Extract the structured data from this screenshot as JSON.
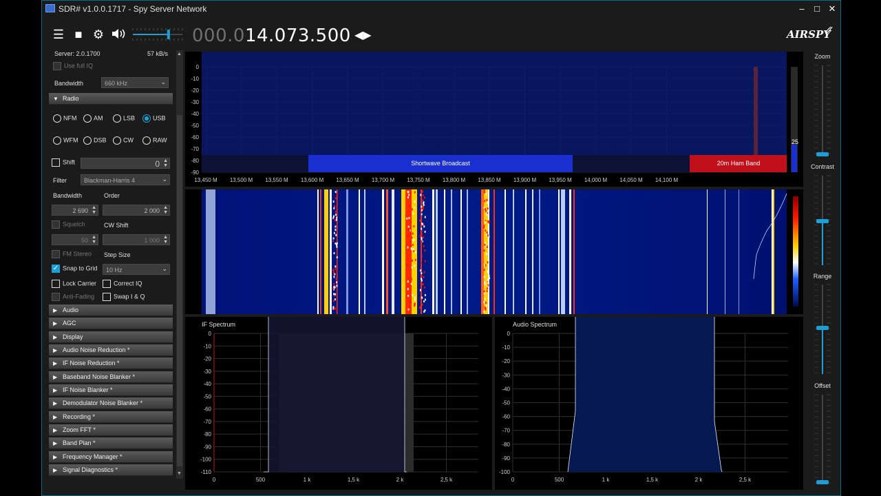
{
  "window": {
    "title": "SDR# v1.0.0.1717 - Spy Server Network"
  },
  "toolbar": {
    "freq_dim": "000.0",
    "freq_bright": "14.073.500",
    "logo": "AIRSPY",
    "volume_level": 0.72
  },
  "sidebar": {
    "server_label": "Server: 2.0.1700",
    "server_rate": "57 kB/s",
    "use_full_iq": "Use full IQ",
    "bandwidth_label": "Bandwidth",
    "bandwidth_value": "660 kHz",
    "radio_section": "Radio",
    "modes_row1": [
      "NFM",
      "AM",
      "LSB",
      "USB"
    ],
    "modes_row2": [
      "WFM",
      "DSB",
      "CW",
      "RAW"
    ],
    "selected_mode": "USB",
    "shift_label": "Shift",
    "shift_value": "0",
    "filter_label": "Filter",
    "filter_value": "Blackman-Harris 4",
    "bw_label": "Bandwidth",
    "order_label": "Order",
    "bw_value": "2 690",
    "order_value": "2 000",
    "squelch_label": "Squelch",
    "cw_shift_label": "CW Shift",
    "squelch_value": "50",
    "cw_shift_value": "1 000",
    "fm_stereo": "FM Stereo",
    "step_size_label": "Step Size",
    "snap_to_grid": "Snap to Grid",
    "step_value": "10 Hz",
    "lock_carrier": "Lock Carrier",
    "correct_iq": "Correct IQ",
    "anti_fading": "Anti-Fading",
    "swap_iq": "Swap I & Q",
    "sections": [
      "Audio",
      "AGC",
      "Display",
      "Audio Noise Reduction *",
      "IF Noise Reduction *",
      "Baseband Noise Blanker *",
      "IF Noise Blanker *",
      "Demodulator Noise Blanker *",
      "Recording *",
      "Zoom FFT *",
      "Band Plan *",
      "Frequency Manager *",
      "Signal Diagnostics *"
    ]
  },
  "spectrum": {
    "y_ticks": [
      "0",
      "-10",
      "-20",
      "-30",
      "-40",
      "-50",
      "-60",
      "-70",
      "-80",
      "-90"
    ],
    "x_ticks": [
      "13,450 M",
      "13,500 M",
      "13,550 M",
      "13,600 M",
      "13,650 M",
      "13,700 M",
      "13,750 M",
      "13,800 M",
      "13,850 M",
      "13,900 M",
      "13,950 M",
      "14,000 M",
      "14,050 M",
      "14,100 M"
    ],
    "band_shortwave": "Shortwave Broadcast",
    "band_ham": "20m Ham Band",
    "level_readout": "25",
    "colors": {
      "shortwave": "#1a2fd0",
      "ham": "#c0101a",
      "trace": "#e8f2ff"
    }
  },
  "if_spectrum": {
    "title": "IF Spectrum",
    "y_ticks": [
      "0",
      "-10",
      "-20",
      "-30",
      "-40",
      "-50",
      "-60",
      "-70",
      "-80",
      "-90",
      "-100",
      "-110"
    ],
    "x_ticks": [
      "0",
      "500",
      "1 k",
      "1,5 k",
      "2 k",
      "2,5 k"
    ]
  },
  "audio_spectrum": {
    "title": "Audio Spectrum",
    "y_ticks": [
      "0",
      "-10",
      "-20",
      "-30",
      "-40",
      "-50",
      "-60",
      "-70",
      "-80",
      "-90",
      "-100"
    ],
    "x_ticks": [
      "0",
      "500",
      "1 k",
      "1,5 k",
      "2 k",
      "2,5 k"
    ]
  },
  "right_controls": {
    "zoom": "Zoom",
    "contrast": "Contrast",
    "range": "Range",
    "offset": "Offset"
  }
}
